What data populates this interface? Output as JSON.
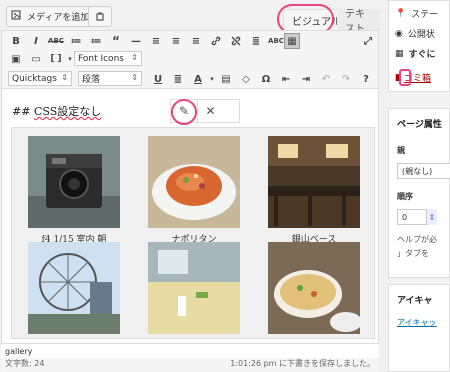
{
  "toolbar_top": {
    "add_media_label": "メディアを追加",
    "tab_visual": "ビジュアル",
    "tab_text": "テキスト"
  },
  "toolbar": {
    "row1": [
      "B",
      "I",
      "ABC",
      "•≡",
      "1≡",
      "❝",
      "—",
      "≡",
      "≡",
      "≡",
      "🔗",
      "⛓",
      "≡",
      "⌨",
      "ABC",
      "▦"
    ],
    "font_select": "Font Icons",
    "quicktags_select": "Quicktags",
    "format_select": "段落"
  },
  "editor": {
    "heading_prefix": "## ",
    "heading_text": "CSS設定なし",
    "gallery": [
      {
        "caption": "f4 1/15 室内 朝",
        "image": "camera"
      },
      {
        "caption": "ナポリタン",
        "image": "spaghetti"
      },
      {
        "caption": "銀山ベース",
        "image": "cafe"
      },
      {
        "caption": "",
        "image": "ferris-wheel"
      },
      {
        "caption": "",
        "image": "table"
      },
      {
        "caption": "",
        "image": "pizza"
      }
    ],
    "status_path": "gallery",
    "word_count": "文字数: 24",
    "draft_saved": "1:01:26 pm に下書きを保存しました。"
  },
  "sidebar": {
    "status_label": "ステー",
    "visibility_label": "公開状",
    "publish_label": "すぐに",
    "trash_label": "ゴミ箱",
    "page_attr_title": "ページ属性",
    "parent_label": "親",
    "parent_value": "(親なし)",
    "order_label": "順序",
    "order_value": "0",
    "help_text_1": "ヘルプが必",
    "help_text_2": "」タブを",
    "eyecatch_title": "アイキャ",
    "eyecatch_link": "アイキャッ"
  }
}
